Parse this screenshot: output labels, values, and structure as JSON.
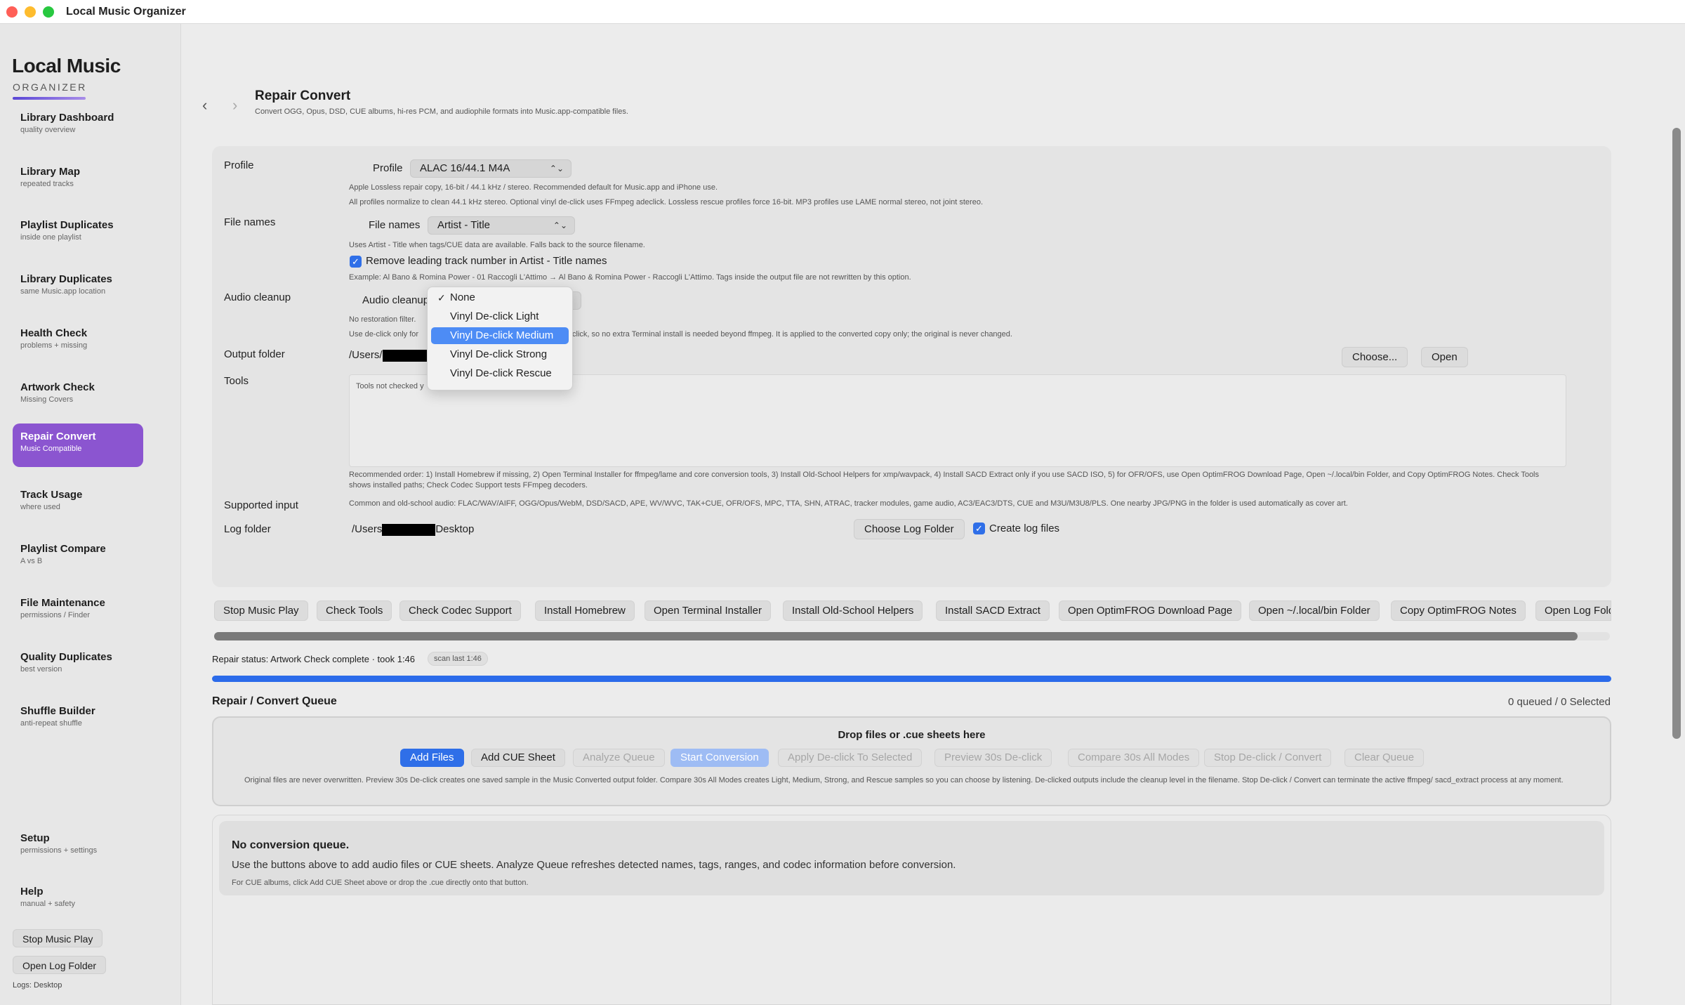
{
  "window": {
    "title": "Local Music Organizer"
  },
  "sidebar": {
    "logo_title": "Local Music",
    "logo_sub": "ORGANIZER",
    "items": [
      {
        "label": "Library Dashboard",
        "sub": "quality overview"
      },
      {
        "label": "Library Map",
        "sub": "repeated tracks"
      },
      {
        "label": "Playlist Duplicates",
        "sub": "inside one playlist"
      },
      {
        "label": "Library Duplicates",
        "sub": "same Music.app location"
      },
      {
        "label": "Health Check",
        "sub": "problems + missing"
      },
      {
        "label": "Artwork Check",
        "sub": "Missing Covers"
      },
      {
        "label": "Repair Convert",
        "sub": "Music Compatible"
      },
      {
        "label": "Track Usage",
        "sub": "where used"
      },
      {
        "label": "Playlist Compare",
        "sub": "A vs B"
      },
      {
        "label": "File Maintenance",
        "sub": "permissions / Finder"
      },
      {
        "label": "Quality Duplicates",
        "sub": "best version"
      },
      {
        "label": "Shuffle Builder",
        "sub": "anti-repeat shuffle"
      }
    ],
    "active_index": 6,
    "setup": {
      "label": "Setup",
      "sub": "permissions + settings"
    },
    "help": {
      "label": "Help",
      "sub": "manual + safety"
    },
    "stop_music_play": "Stop Music Play",
    "open_log_folder": "Open Log Folder",
    "logs_label": "Logs: Desktop"
  },
  "header": {
    "back_icon": "‹",
    "forward_icon": "›",
    "title": "Repair Convert",
    "subtitle": "Convert OGG, Opus, DSD, CUE albums, hi-res PCM, and audiophile formats into Music.app-compatible files."
  },
  "form": {
    "profile_section": "Profile",
    "profile_label": "Profile",
    "profile_value": "ALAC 16/44.1 M4A",
    "profile_note1": "Apple Lossless repair copy, 16-bit / 44.1 kHz / stereo. Recommended default for Music.app and iPhone use.",
    "profile_note2": "All profiles normalize to clean 44.1 kHz stereo. Optional vinyl de-click uses FFmpeg adeclick. Lossless rescue profiles force 16-bit. MP3 profiles use LAME normal stereo, not joint stereo.",
    "filenames_section": "File names",
    "filenames_label": "File names",
    "filenames_value": "Artist - Title",
    "filenames_note": "Uses Artist - Title when tags/CUE data are available. Falls back to the source filename.",
    "remove_track_number_label": "Remove leading track number in Artist - Title names",
    "remove_track_number_checked": true,
    "filenames_example": "Example: Al Bano & Romina Power - 01 Raccogli L'Attimo → Al Bano & Romina Power - Raccogli L'Attimo. Tags inside the output file are not rewritten by this option.",
    "audio_cleanup_section": "Audio cleanup",
    "audio_cleanup_label": "Audio cleanup",
    "audio_cleanup_note1": "No restoration filter.",
    "audio_cleanup_note2_start": "Use de-click only for",
    "audio_cleanup_note2_end": "click, so no extra Terminal install is needed beyond ffmpeg. It is applied to the converted copy only; the original is never changed.",
    "output_section": "Output folder",
    "output_path_prefix": "/Users/",
    "choose_button": "Choose...",
    "open_button": "Open",
    "tools_section": "Tools",
    "tools_placeholder": "Tools not checked y",
    "tools_note": "Recommended order: 1) Install Homebrew if missing, 2) Open Terminal Installer for ffmpeg/lame and core conversion tools, 3) Install Old-School Helpers for xmp/wavpack, 4) Install SACD Extract only if you use SACD ISO, 5) for OFR/OFS, use Open OptimFROG Download Page, Open ~/.local/bin Folder, and Copy OptimFROG Notes. Check Tools shows installed paths; Check Codec Support tests FFmpeg decoders.",
    "supported_section": "Supported input",
    "supported_text": "Common and old-school audio: FLAC/WAV/AIFF, OGG/Opus/WebM, DSD/SACD, APE, WV/WVC, TAK+CUE, OFR/OFS, MPC, TTA, SHN, ATRAC, tracker modules, game audio, AC3/EAC3/DTS, CUE and M3U/M3U8/PLS. One nearby JPG/PNG in the folder is used automatically as cover art.",
    "log_section": "Log folder",
    "log_path_prefix": "/Users",
    "log_path_suffix": "Desktop",
    "choose_log_button": "Choose Log Folder",
    "create_log_label": "Create log files",
    "create_log_checked": true
  },
  "dropdown": {
    "options": [
      "None",
      "Vinyl De-click Light",
      "Vinyl De-click Medium",
      "Vinyl De-click Strong",
      "Vinyl De-click Rescue"
    ],
    "checked_index": 0,
    "highlighted_index": 2,
    "check_glyph": "✓"
  },
  "actions": [
    "Stop Music Play",
    "Check Tools",
    "Check Codec Support",
    "Install Homebrew",
    "Open Terminal Installer",
    "Install Old-School Helpers",
    "Install SACD Extract",
    "Open OptimFROG Download Page",
    "Open ~/.local/bin Folder",
    "Copy OptimFROG Notes",
    "Open Log Fold"
  ],
  "status": {
    "text": "Repair status: Artwork Check complete · took 1:46",
    "chip": "scan last 1:46",
    "progress": 1.0
  },
  "queue": {
    "title": "Repair / Convert Queue",
    "count": "0 queued / 0 Selected",
    "drop_title": "Drop files or .cue sheets here",
    "buttons": [
      {
        "label": "Add Files",
        "state": "primary"
      },
      {
        "label": "Add CUE Sheet",
        "state": "normal"
      },
      {
        "label": "Analyze Queue",
        "state": "disabled"
      },
      {
        "label": "Start Conversion",
        "state": "primary-disabled"
      },
      {
        "label": "Apply De-click To Selected",
        "state": "disabled"
      },
      {
        "label": "Preview 30s De-click",
        "state": "disabled"
      },
      {
        "label": "Compare 30s All Modes",
        "state": "disabled"
      },
      {
        "label": "Stop De-click / Convert",
        "state": "disabled"
      },
      {
        "label": "Clear Queue",
        "state": "disabled"
      }
    ],
    "drop_note": "Original files are never overwritten. Preview 30s De-click creates one saved sample in the Music Converted output folder. Compare 30s All Modes creates Light, Medium, Strong, and Rescue samples so you can choose by listening. De-clicked outputs include the cleanup level in the filename. Stop De-click / Convert can terminate the active ffmpeg/ sacd_extract process at any moment.",
    "empty_title": "No conversion queue.",
    "empty_body": "Use the buttons above to add audio files or CUE sheets. Analyze Queue refreshes detected names, tags, ranges, and codec information before conversion.",
    "empty_note": "For CUE albums, click Add CUE Sheet above or drop the .cue directly onto that button."
  }
}
